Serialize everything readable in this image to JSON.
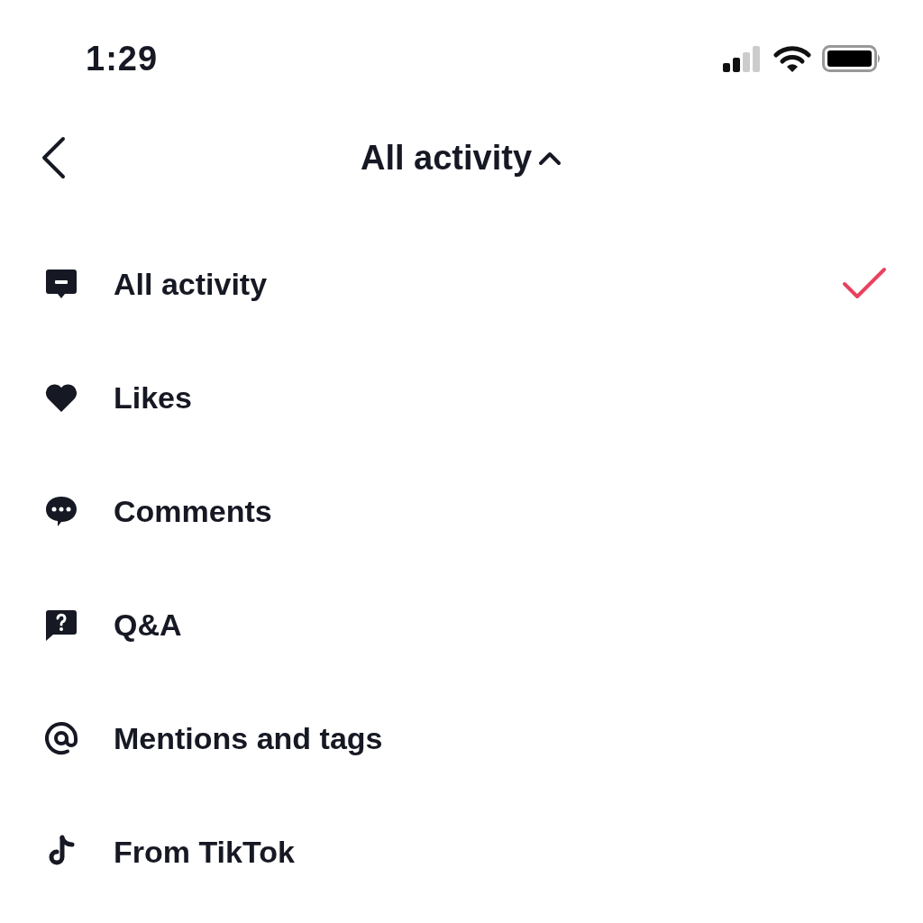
{
  "status_bar": {
    "time": "1:29"
  },
  "header": {
    "title": "All activity",
    "expanded": true
  },
  "menu": [
    {
      "label": "All activity",
      "kind": "activity",
      "selected": true
    },
    {
      "label": "Likes",
      "kind": "likes",
      "selected": false
    },
    {
      "label": "Comments",
      "kind": "comments",
      "selected": false
    },
    {
      "label": "Q&A",
      "kind": "qa",
      "selected": false
    },
    {
      "label": "Mentions and tags",
      "kind": "mentions",
      "selected": false
    },
    {
      "label": "From TikTok",
      "kind": "tiktok",
      "selected": false
    }
  ]
}
